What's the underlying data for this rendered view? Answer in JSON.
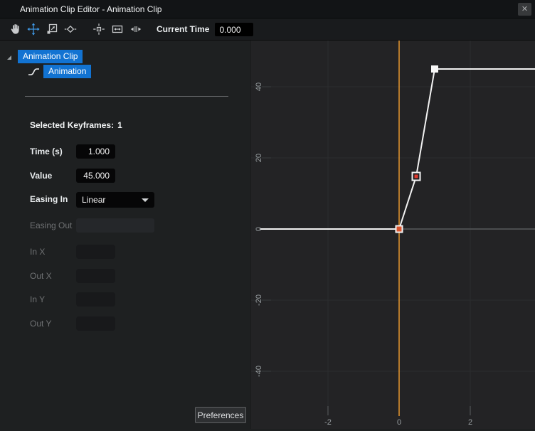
{
  "window": {
    "title": "Animation Clip Editor - Animation Clip",
    "close_label": "✕"
  },
  "toolbar": {
    "tools": [
      {
        "name": "pan",
        "icon": "hand-icon",
        "active": false
      },
      {
        "name": "move",
        "icon": "move-arrows-icon",
        "active": true
      },
      {
        "name": "scale",
        "icon": "scale-icon",
        "active": false
      },
      {
        "name": "add-keyframe",
        "icon": "diamond-icon",
        "active": false
      },
      {
        "name": "center-view",
        "icon": "crosshair-icon",
        "active": false
      },
      {
        "name": "fit-horizontal",
        "icon": "fit-horizontal-icon",
        "active": false
      },
      {
        "name": "fit-vertical",
        "icon": "split-arrows-icon",
        "active": false
      }
    ],
    "current_time": {
      "label": "Current Time",
      "value": "0.000"
    }
  },
  "tree": {
    "items": [
      {
        "label": "Animation Clip",
        "level": 0,
        "expanded": true,
        "selected": true
      },
      {
        "label": "Animation",
        "level": 1,
        "icon": "animation-curve-icon",
        "selected": true
      }
    ]
  },
  "properties": {
    "selected_keyframes": {
      "label": "Selected Keyframes:",
      "count": "1"
    },
    "fields": [
      {
        "label": "Time (s)",
        "value": "1.000",
        "enabled": true,
        "control": "number"
      },
      {
        "label": "Value",
        "value": "45.000",
        "enabled": true,
        "control": "number"
      },
      {
        "label": "Easing In",
        "value": "Linear",
        "enabled": true,
        "control": "dropdown"
      },
      {
        "label": "Easing Out",
        "value": "",
        "enabled": false,
        "control": "input"
      },
      {
        "label": "In X",
        "value": "",
        "enabled": false,
        "control": "input"
      },
      {
        "label": "Out X",
        "value": "",
        "enabled": false,
        "control": "input"
      },
      {
        "label": "In Y",
        "value": "",
        "enabled": false,
        "control": "input"
      },
      {
        "label": "Out Y",
        "value": "",
        "enabled": false,
        "control": "input"
      }
    ],
    "preferences_button": "Preferences"
  },
  "chart_data": {
    "type": "line",
    "x_ticks": [
      -2,
      0,
      2
    ],
    "y_ticks": [
      40,
      20,
      0,
      -20,
      -40
    ],
    "current_time": 0,
    "keyframes": [
      {
        "time": 0,
        "value": 0,
        "marker": "keyframe-start"
      },
      {
        "time": 0.48,
        "value": 14.8,
        "marker": "selected"
      },
      {
        "time": 1,
        "value": 45,
        "marker": "keyframe"
      }
    ],
    "extend_left_value": 0,
    "extend_right_value": 45,
    "colors": {
      "curve": "#f2f2f2",
      "current_time_line": "#e8982f",
      "selected": "#e23a2e",
      "grid": "#2b2d2f",
      "zero_axis": "#4b4d4f",
      "tick_label": "#9aa0a3"
    }
  },
  "colors": {
    "accent_blue": "#1273d2"
  }
}
